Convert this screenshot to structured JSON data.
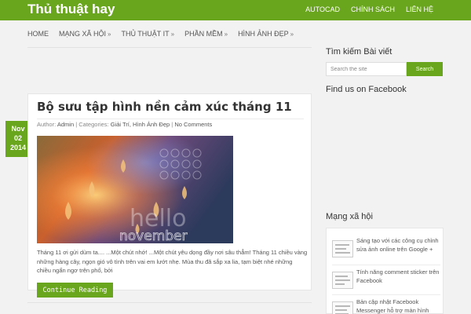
{
  "site": {
    "title": "Thủ thuật hay"
  },
  "top_menu": [
    "AUTOCAD",
    "CHÍNH SÁCH",
    "LIÊN HỆ"
  ],
  "main_nav": [
    {
      "label": "HOME",
      "has_children": false
    },
    {
      "label": "MẠNG XÃ HỘI",
      "has_children": true
    },
    {
      "label": "THỦ THUẬT IT",
      "has_children": true
    },
    {
      "label": "PHẦN MỀM",
      "has_children": true
    },
    {
      "label": "HÌNH ẢNH ĐẸP",
      "has_children": true
    }
  ],
  "post": {
    "date_month": "Nov",
    "date_day": "02",
    "date_year": "2014",
    "title": "Bộ sưu tập hình nền cảm xúc tháng 11",
    "meta_author_prefix": "Author:",
    "meta_author": "Admin",
    "meta_sep": "|",
    "meta_categories_prefix": "Categories:",
    "meta_categories": "Giải Trí, Hình Ảnh Đẹp",
    "meta_comments": "No Comments",
    "image_text": "november",
    "excerpt": "Tháng 11 ơi gửi dùm ta.... ...Một chút nhớ! ...Một chút yêu dọng đầy nơi sâu thẳm! Tháng 11 chiều vàng những hàng cây, ngọn gió vô tình trên vai em lướt nhẹ. Mùa thu đã sắp xa lia, tạm biệt nhé những chiều ngẩn ngơ trên phố, bởi",
    "read_more": "Continue Reading"
  },
  "sidebar": {
    "search_title": "Tìm kiếm Bài viết",
    "search_placeholder": "Search the site",
    "search_button": "Search",
    "facebook_title": "Find us on Facebook",
    "social_title": "Mạng xã hội",
    "social_items": [
      "Sáng tạo với các công cụ chỉnh sửa ảnh online trên Google +",
      "Tính năng comment sticker trên Facebook",
      "Bản cập nhật Facebook Messenger hỗ trợ màn hình"
    ]
  },
  "colors": {
    "accent": "#6aa51e",
    "background": "#f2f2f2"
  }
}
